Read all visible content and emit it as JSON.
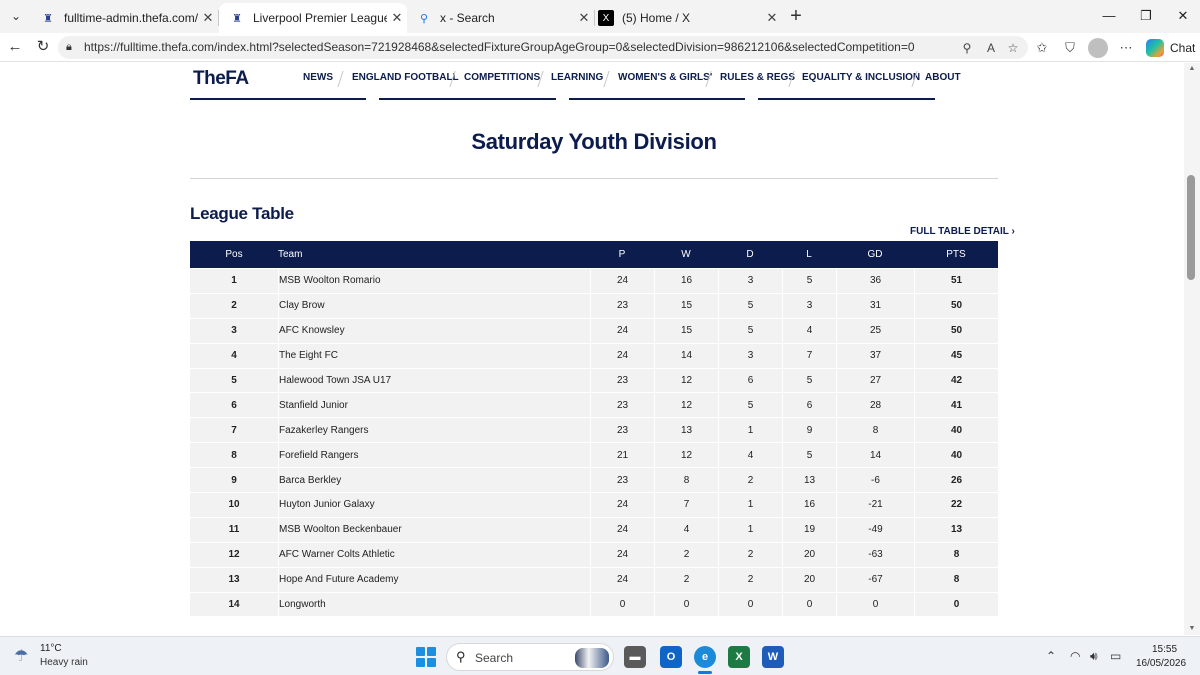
{
  "browser": {
    "tabs": [
      {
        "title": "fulltime-admin.thefa.com/gen/Cha",
        "favicon": "fa-crest-icon"
      },
      {
        "title": "Liverpool Premier League",
        "favicon": "fa-crest-icon",
        "active": true
      },
      {
        "title": "x - Search",
        "favicon": "search-icon"
      },
      {
        "title": "(5) Home / X",
        "favicon": "x-logo-icon"
      }
    ],
    "url": "https://fulltime.thefa.com/index.html?selectedSeason=721928468&selectedFixtureGroupAgeGroup=0&selectedDivision=986212106&selectedCompetition=0",
    "chat_label": "Chat"
  },
  "site": {
    "logo": "TheFA",
    "menu": [
      "NEWS",
      "ENGLAND FOOTBALL",
      "COMPETITIONS",
      "LEARNING",
      "WOMEN'S & GIRLS'",
      "RULES & REGS",
      "EQUALITY & INCLUSION",
      "ABOUT"
    ]
  },
  "page": {
    "title": "Saturday Youth Division",
    "section_title": "League Table",
    "full_table_link": "FULL TABLE DETAIL ›"
  },
  "table": {
    "headers": {
      "pos": "Pos",
      "team": "Team",
      "p": "P",
      "w": "W",
      "d": "D",
      "l": "L",
      "gd": "GD",
      "pts": "PTS"
    },
    "rows": [
      {
        "pos": "1",
        "team": "MSB Woolton Romario",
        "p": "24",
        "w": "16",
        "d": "3",
        "l": "5",
        "gd": "36",
        "pts": "51"
      },
      {
        "pos": "2",
        "team": "Clay Brow",
        "p": "23",
        "w": "15",
        "d": "5",
        "l": "3",
        "gd": "31",
        "pts": "50"
      },
      {
        "pos": "3",
        "team": "AFC Knowsley",
        "p": "24",
        "w": "15",
        "d": "5",
        "l": "4",
        "gd": "25",
        "pts": "50"
      },
      {
        "pos": "4",
        "team": "The Eight FC",
        "p": "24",
        "w": "14",
        "d": "3",
        "l": "7",
        "gd": "37",
        "pts": "45"
      },
      {
        "pos": "5",
        "team": "Halewood Town JSA U17",
        "p": "23",
        "w": "12",
        "d": "6",
        "l": "5",
        "gd": "27",
        "pts": "42"
      },
      {
        "pos": "6",
        "team": "Stanfield Junior",
        "p": "23",
        "w": "12",
        "d": "5",
        "l": "6",
        "gd": "28",
        "pts": "41"
      },
      {
        "pos": "7",
        "team": "Fazakerley Rangers",
        "p": "23",
        "w": "13",
        "d": "1",
        "l": "9",
        "gd": "8",
        "pts": "40"
      },
      {
        "pos": "8",
        "team": "Forefield Rangers",
        "p": "21",
        "w": "12",
        "d": "4",
        "l": "5",
        "gd": "14",
        "pts": "40"
      },
      {
        "pos": "9",
        "team": "Barca Berkley",
        "p": "23",
        "w": "8",
        "d": "2",
        "l": "13",
        "gd": "-6",
        "pts": "26"
      },
      {
        "pos": "10",
        "team": "Huyton Junior Galaxy",
        "p": "24",
        "w": "7",
        "d": "1",
        "l": "16",
        "gd": "-21",
        "pts": "22"
      },
      {
        "pos": "11",
        "team": "MSB Woolton Beckenbauer",
        "p": "24",
        "w": "4",
        "d": "1",
        "l": "19",
        "gd": "-49",
        "pts": "13"
      },
      {
        "pos": "12",
        "team": "AFC Warner Colts Athletic",
        "p": "24",
        "w": "2",
        "d": "2",
        "l": "20",
        "gd": "-63",
        "pts": "8"
      },
      {
        "pos": "13",
        "team": "Hope And Future Academy",
        "p": "24",
        "w": "2",
        "d": "2",
        "l": "20",
        "gd": "-67",
        "pts": "8"
      },
      {
        "pos": "14",
        "team": "Longworth",
        "p": "0",
        "w": "0",
        "d": "0",
        "l": "0",
        "gd": "0",
        "pts": "0"
      }
    ]
  },
  "taskbar": {
    "temperature": "11°C",
    "weather": "Heavy rain",
    "search_label": "Search",
    "time": "15:55",
    "date": "16/05/2026"
  },
  "colors": {
    "brand_navy": "#0c1c4c",
    "row_bg": "#f2f2f2"
  }
}
